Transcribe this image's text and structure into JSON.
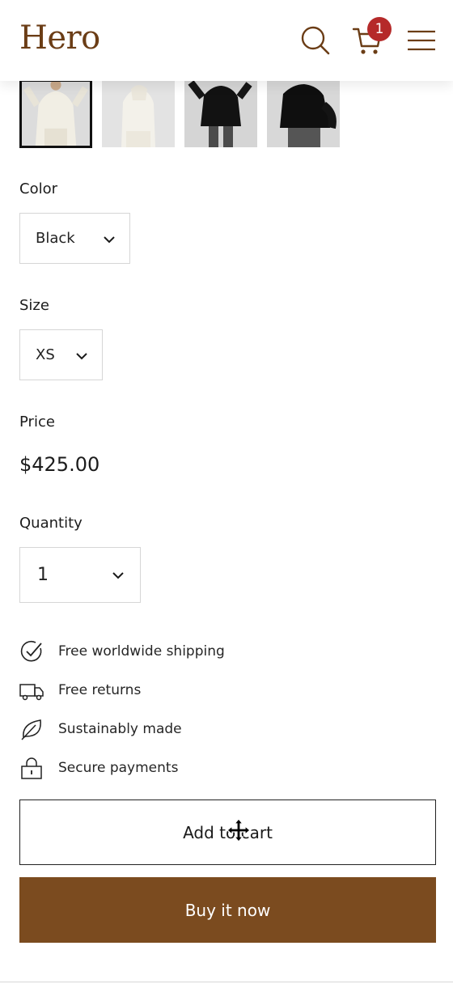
{
  "header": {
    "logo": "Hero",
    "cart_count": "1",
    "icons": [
      "search-icon",
      "cart-icon",
      "menu-icon"
    ],
    "brand_color": "#6b3d16",
    "badge_color": "#b52a2a"
  },
  "gallery": {
    "thumbnails": [
      {
        "alt": "cream hoodie front",
        "selected": true
      },
      {
        "alt": "cream hoodie side",
        "selected": false
      },
      {
        "alt": "black hoodie front",
        "selected": false
      },
      {
        "alt": "black hoodie back",
        "selected": false
      }
    ]
  },
  "product": {
    "color_label": "Color",
    "color_value": "Black",
    "size_label": "Size",
    "size_value": "XS",
    "price_label": "Price",
    "price_value": "$425.00",
    "quantity_label": "Quantity",
    "quantity_value": "1"
  },
  "features": [
    {
      "icon": "check-circle-icon",
      "text": "Free worldwide shipping"
    },
    {
      "icon": "truck-icon",
      "text": "Free returns"
    },
    {
      "icon": "leaf-icon",
      "text": "Sustainably made"
    },
    {
      "icon": "lock-icon",
      "text": "Secure payments"
    }
  ],
  "actions": {
    "add_to_cart": "Add to cart",
    "buy_now": "Buy it now",
    "buy_color": "#7b4b1f"
  }
}
